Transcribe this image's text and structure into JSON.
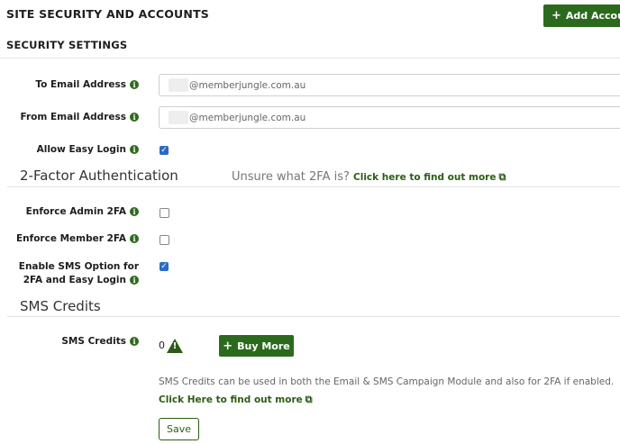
{
  "header": {
    "title": "SITE SECURITY AND ACCOUNTS",
    "subtitle": "SECURITY SETTINGS",
    "add_button_label": "Add Accoun"
  },
  "security": {
    "to_email_label": "To Email Address",
    "to_email_value": "@memberjungle.com.au",
    "from_email_label": "From Email Address",
    "from_email_value": "@memberjungle.com.au",
    "allow_easy_login_label": "Allow Easy Login",
    "allow_easy_login_checked": true
  },
  "two_factor": {
    "section_title": "2-Factor Authentication",
    "hint_text": "Unsure what 2FA is?",
    "hint_link": "Click here to find out more",
    "enforce_admin_label": "Enforce Admin 2FA",
    "enforce_admin_checked": false,
    "enforce_member_label": "Enforce Member 2FA",
    "enforce_member_checked": false,
    "sms_option_label": "Enable SMS Option for 2FA and Easy Login",
    "sms_option_checked": true
  },
  "sms": {
    "section_title": "SMS Credits",
    "credits_label": "SMS Credits",
    "credits_value": "0",
    "warning_icon": "warning-triangle-icon",
    "buy_more_label": "Buy More",
    "description": "SMS Credits can be used in both the Email & SMS Campaign Module and also for 2FA if enabled.",
    "description_link": "Click Here to find out more"
  },
  "footer": {
    "save_label": "Save"
  },
  "colors": {
    "brand_green": "#2b6a1d",
    "checkbox_blue": "#2b6bc4"
  }
}
